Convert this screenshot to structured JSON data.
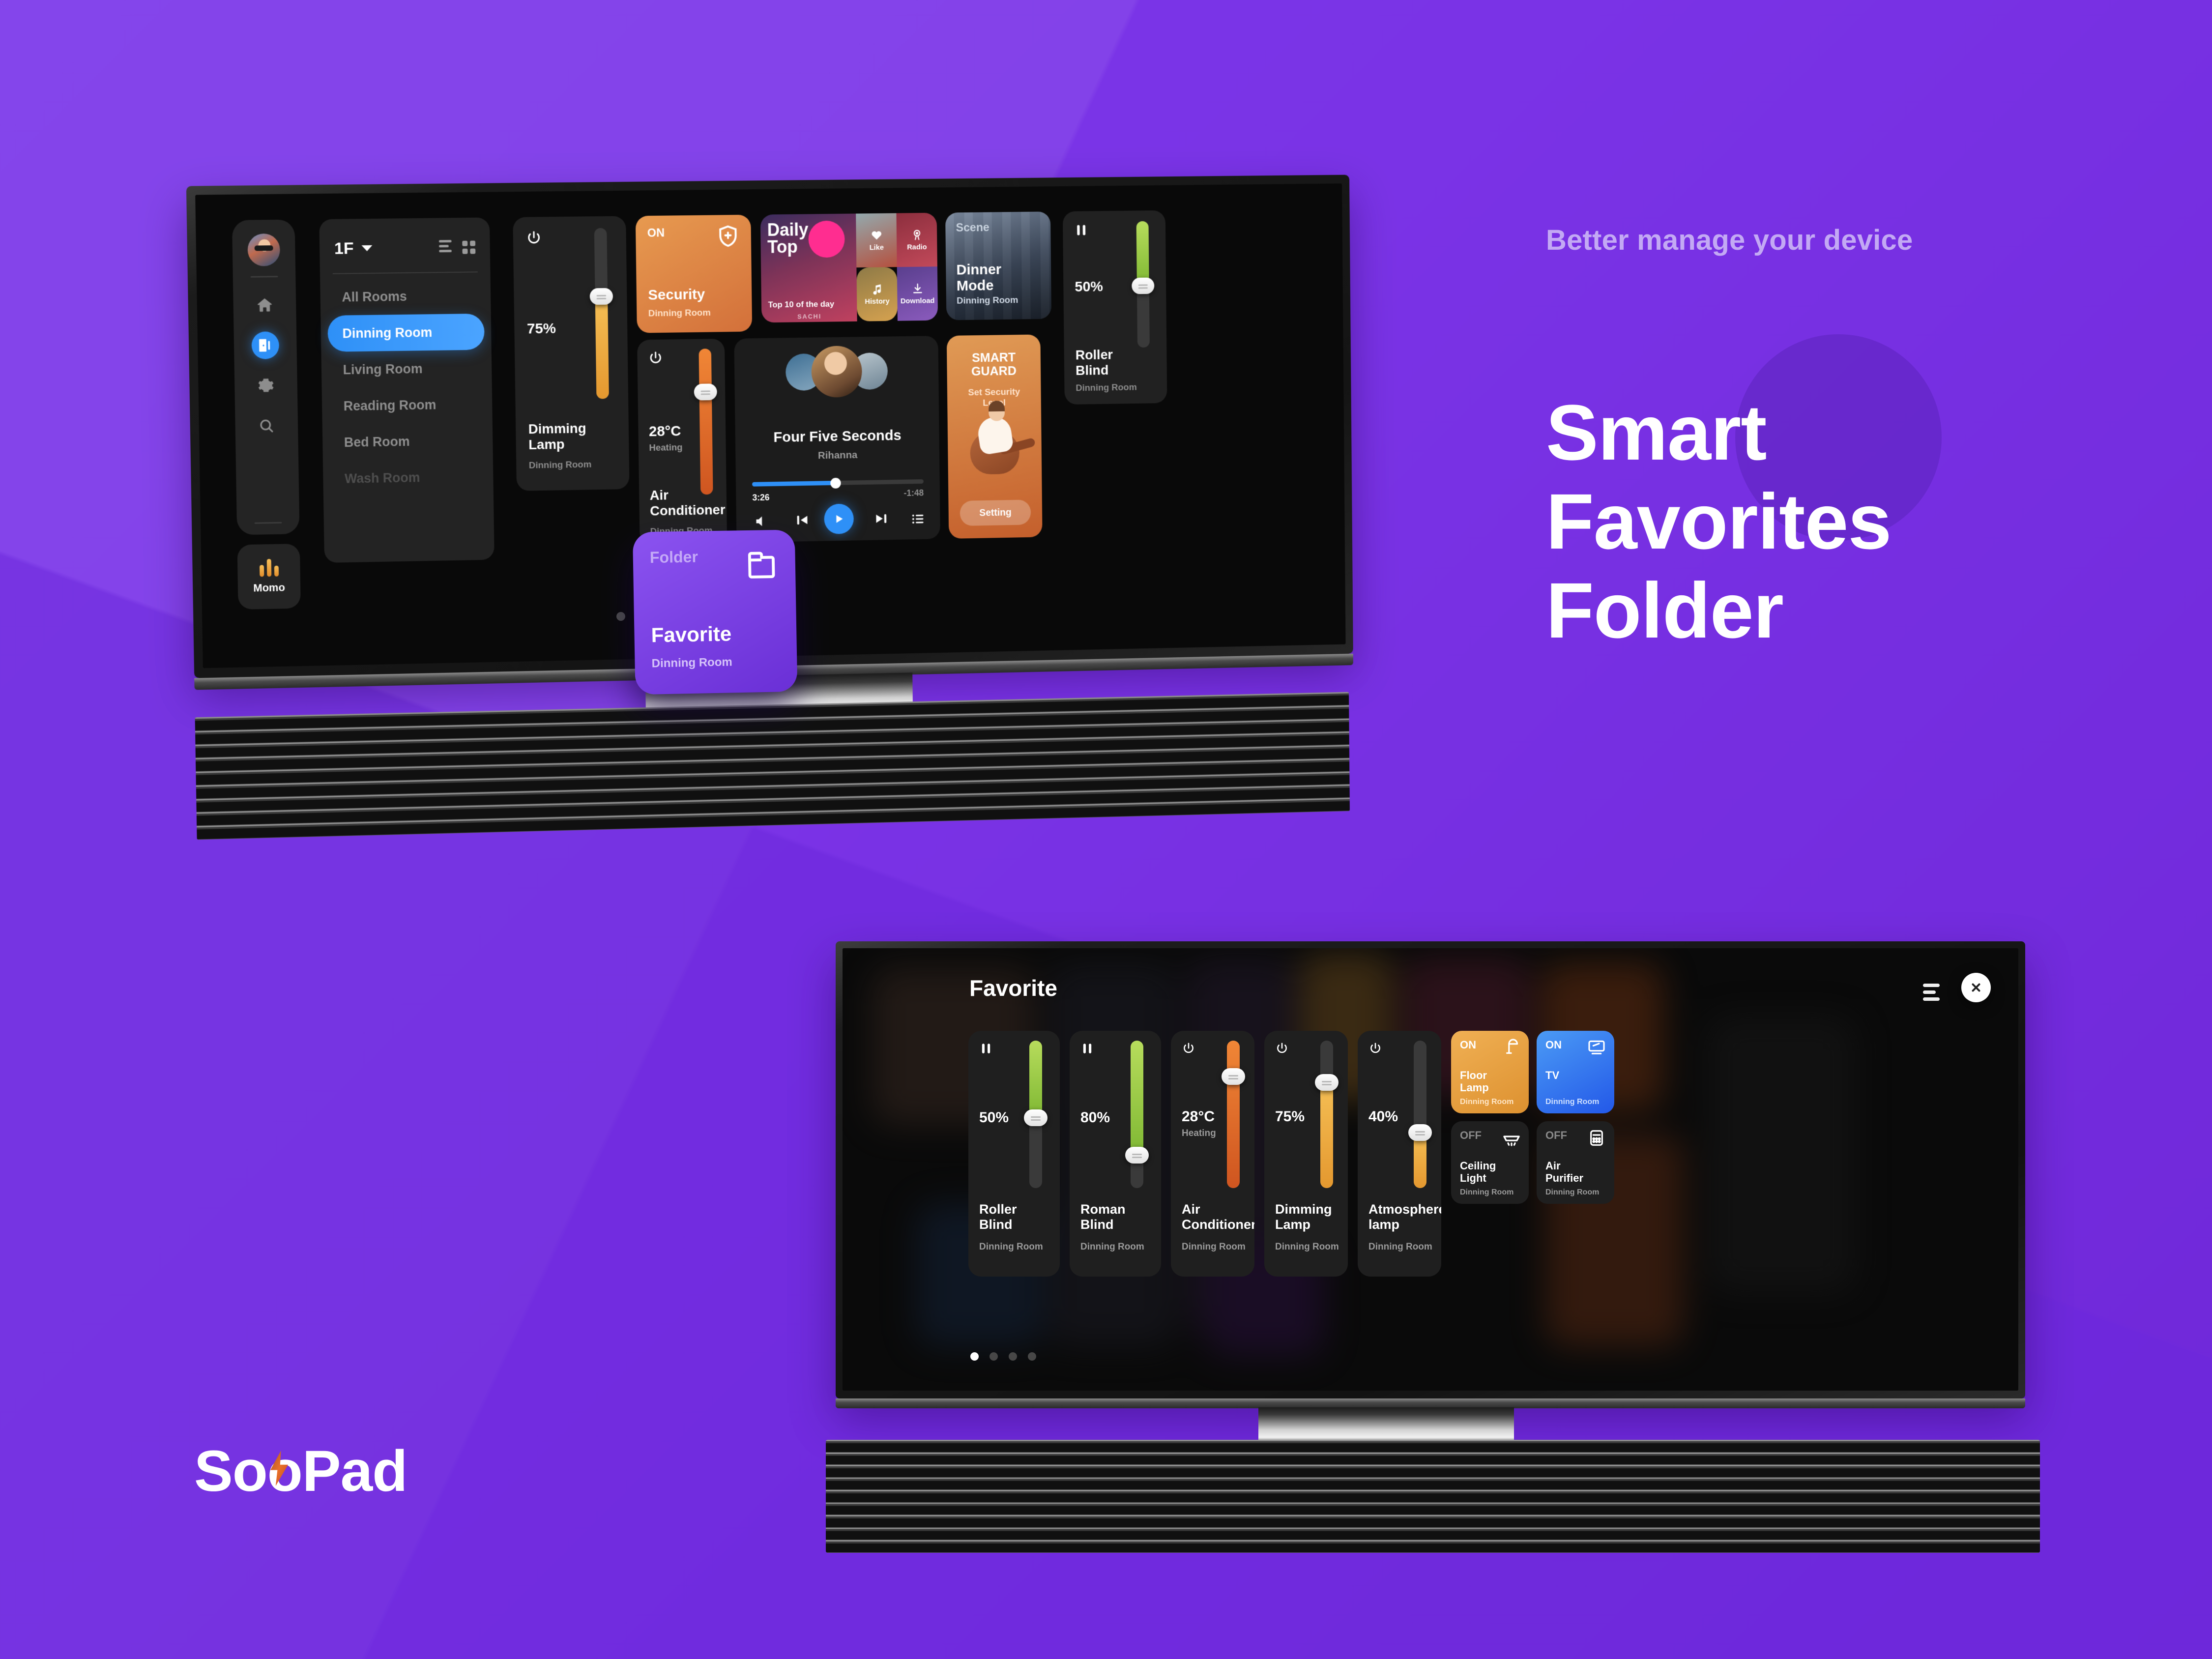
{
  "marketing": {
    "kicker": "Better manage your device",
    "headline_l1": "Smart",
    "headline_l2": "Favorites",
    "headline_l3": "Folder",
    "logo_part1": "Soo",
    "logo_part2": "Pad",
    "brand_purple": "#7a35e8",
    "accent_blue": "#2e90f7",
    "accent_orange": "#dd9130",
    "accent_green": "#8ec63f"
  },
  "tv1": {
    "rail": {
      "avatar_name": "user-avatar",
      "items": [
        {
          "name": "home-icon",
          "active": false
        },
        {
          "name": "rooms-icon",
          "active": true
        },
        {
          "name": "gear-icon",
          "active": false
        },
        {
          "name": "search-icon",
          "active": false
        }
      ],
      "momo_label": "Momo"
    },
    "room_panel": {
      "floor": "1F",
      "rooms": [
        {
          "label": "All Rooms",
          "state": "normal"
        },
        {
          "label": "Dinning Room",
          "state": "active"
        },
        {
          "label": "Living Room",
          "state": "normal"
        },
        {
          "label": "Reading Room",
          "state": "normal"
        },
        {
          "label": "Bed Room",
          "state": "normal"
        },
        {
          "label": "Wash Room",
          "state": "dim"
        }
      ]
    },
    "cards": {
      "dimming_lamp": {
        "value": "75%",
        "title": "Dimming Lamp",
        "room": "Dinning Room",
        "fill_pct": 62
      },
      "security": {
        "state": "ON",
        "title": "Security",
        "room": "Dinning Room"
      },
      "daily_top": {
        "title_l1": "Daily",
        "title_l2": "Top",
        "subtitle": "Top 10 of the day",
        "watermark": "SACHI",
        "tiles": [
          "Like",
          "Radio",
          "History",
          "Download"
        ]
      },
      "scene": {
        "label": "Scene",
        "title_l1": "Dinner",
        "title_l2": "Mode",
        "room": "Dinning Room"
      },
      "air_conditioner": {
        "value": "28°C",
        "mode": "Heating",
        "title": "Air Conditioner",
        "room": "Dinning Room",
        "fill_pct": 88
      },
      "music": {
        "title": "Four Five Seconds",
        "artist": "Rihanna",
        "elapsed": "3:26",
        "remaining": "-1:48",
        "progress_pct": 48
      },
      "smart_guard": {
        "title_l1": "SMART",
        "title_l2": "GUARD",
        "subtitle_l1": "Set Security",
        "subtitle_l2": "Level",
        "button": "Setting"
      },
      "roller_blind": {
        "value": "50%",
        "title_l1": "Roller",
        "title_l2": "Blind",
        "room": "Dinning Room",
        "fill_pct": 50
      },
      "folder": {
        "label": "Folder",
        "title": "Favorite",
        "room": "Dinning Room"
      }
    }
  },
  "tv2": {
    "header": {
      "title": "Favorite",
      "menu_icon": "list-icon",
      "close_icon": "close-icon"
    },
    "pagination": {
      "total": 4,
      "current": 1
    },
    "devices": [
      {
        "type": "slider",
        "icon": "pause-icon",
        "value": "50%",
        "sub": "",
        "title_l1": "Roller",
        "title_l2": "Blind",
        "room": "Dinning Room",
        "fill_pct": 52,
        "fill_color": "#8ec63f"
      },
      {
        "type": "slider",
        "icon": "pause-icon",
        "value": "80%",
        "sub": "",
        "title_l1": "Roman",
        "title_l2": "Blind",
        "room": "Dinning Room",
        "fill_pct": 77,
        "fill_color": "#8ec63f"
      },
      {
        "type": "slider",
        "icon": "power-icon",
        "value": "28°C",
        "sub": "Heating",
        "title_l1": "Air",
        "title_l2": "Conditioner",
        "room": "Dinning Room",
        "fill_pct": 88,
        "fill_color": "#e0682a"
      },
      {
        "type": "slider",
        "icon": "power-icon",
        "value": "75%",
        "sub": "",
        "title_l1": "Dimming",
        "title_l2": "Lamp",
        "room": "Dinning Room",
        "fill_pct": 72,
        "fill_color": "#f0a638"
      },
      {
        "type": "slider",
        "icon": "power-icon",
        "value": "40%",
        "sub": "",
        "title_l1": "Atmosphere",
        "title_l2": "lamp",
        "room": "Dinning Room",
        "fill_pct": 38,
        "fill_color": "#f0a638"
      }
    ],
    "toggles": [
      {
        "state": "ON",
        "title_l1": "Floor",
        "title_l2": "Lamp",
        "room": "Dinning Room",
        "icon": "floor-lamp-icon",
        "style": "amber"
      },
      {
        "state": "ON",
        "title_l1": "TV",
        "title_l2": "",
        "room": "Dinning Room",
        "icon": "tv-icon",
        "style": "blue"
      },
      {
        "state": "OFF",
        "title_l1": "Ceiling",
        "title_l2": "Light",
        "room": "Dinning Room",
        "icon": "ceiling-light-icon",
        "style": "dark"
      },
      {
        "state": "OFF",
        "title_l1": "Air",
        "title_l2": "Purifier",
        "room": "Dinning Room",
        "icon": "air-purifier-icon",
        "style": "dark"
      }
    ]
  }
}
